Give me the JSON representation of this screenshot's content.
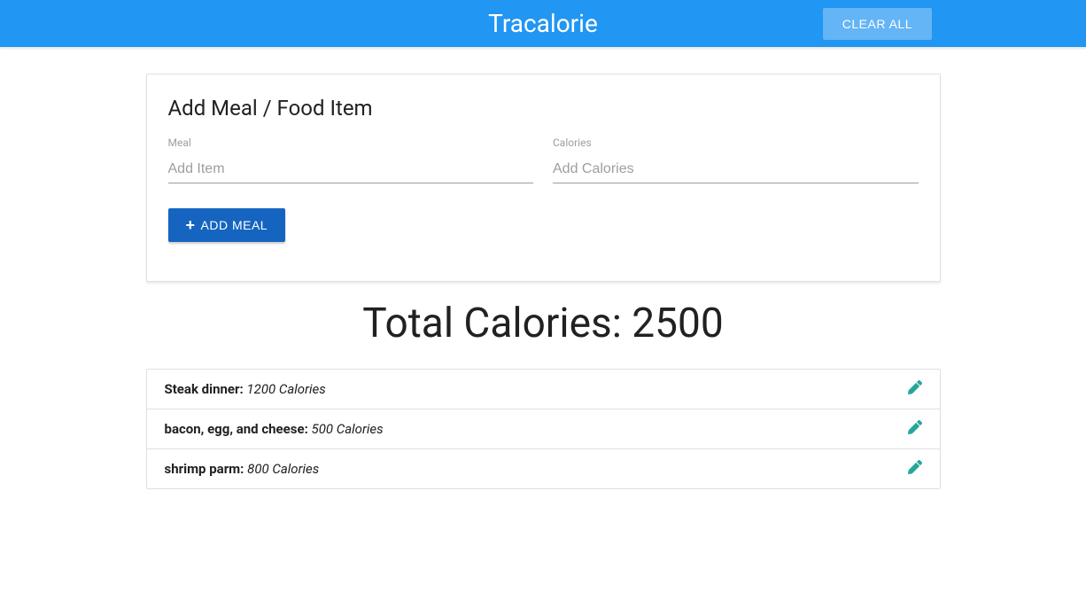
{
  "navbar": {
    "title": "Tracalorie",
    "clear_all_label": "CLEAR ALL"
  },
  "card": {
    "title": "Add Meal / Food Item",
    "meal_label": "Meal",
    "meal_placeholder": "Add Item",
    "calories_label": "Calories",
    "calories_placeholder": "Add Calories",
    "add_meal_label": "ADD MEAL"
  },
  "total": {
    "label": "Total Calories: ",
    "value": "2500"
  },
  "items": [
    {
      "name": "Steak dinner: ",
      "calories": "1200 Calories"
    },
    {
      "name": "bacon, egg, and cheese: ",
      "calories": "500 Calories"
    },
    {
      "name": "shrimp parm: ",
      "calories": "800 Calories"
    }
  ]
}
